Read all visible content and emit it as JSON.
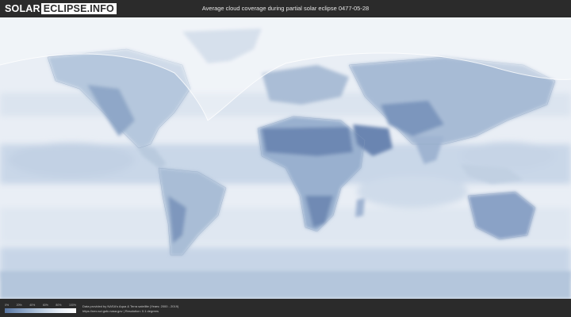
{
  "header": {
    "logo_part1": "SOLAR",
    "logo_part2": "ECLIPSE.INFO",
    "title": "Average cloud coverage during partial solar eclipse 0477-05-28"
  },
  "legend": {
    "ticks": [
      "0%",
      "20%",
      "40%",
      "60%",
      "80%",
      "100%"
    ]
  },
  "footer": {
    "credit_line1": "Data provided by NASA's Aqua & Terra satellite (Years: 2000 - 2019)",
    "credit_line2": "https://neo.sci.gsfc.nasa.gov | Resolution: 0.1 degrees"
  },
  "colors": {
    "background": "#2b2b2b",
    "clear_sky": "#5a77a3",
    "overcast": "#ffffff",
    "eclipse_zone_overlay": "#ffffff"
  }
}
